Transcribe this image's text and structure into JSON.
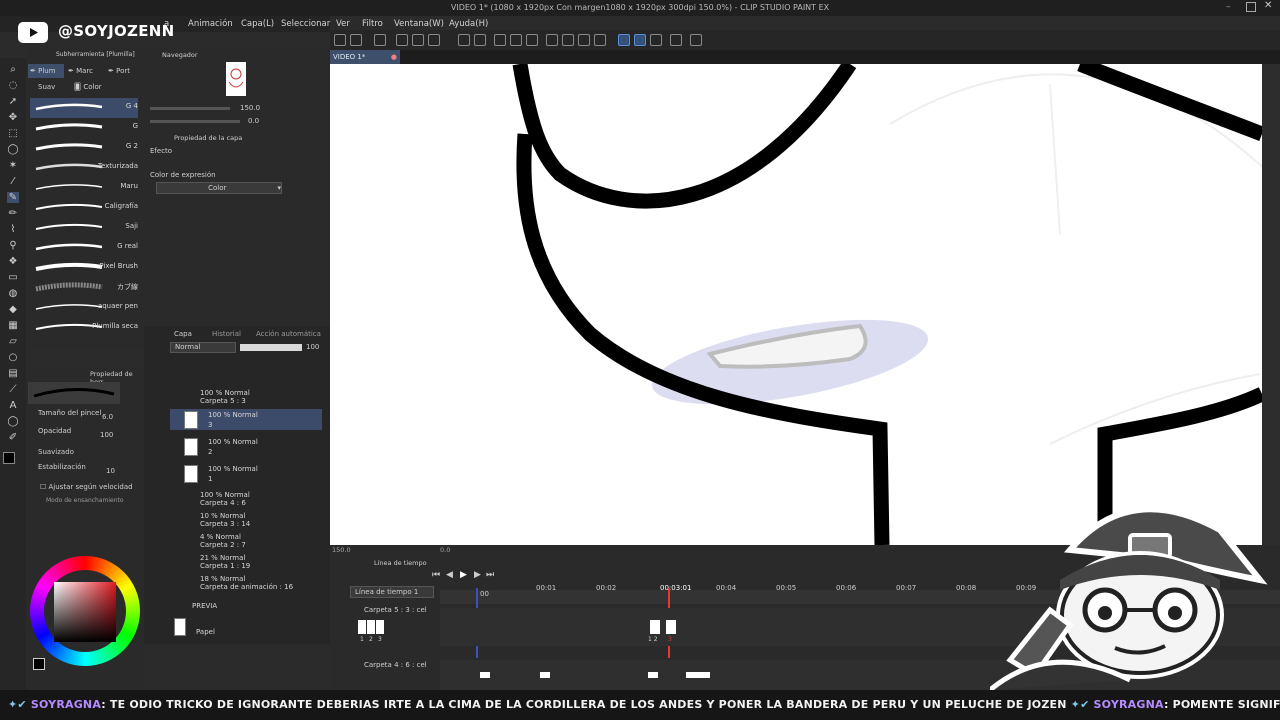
{
  "window": {
    "title": "VIDEO 1* (1080 x 1920px Con margen1080 x 1920px 300dpi 150.0%) - CLIP STUDIO PAINT EX"
  },
  "overlay": {
    "channel": "@SOYJOZENN",
    "logo_icon": "youtube-play-icon"
  },
  "menu": [
    "a",
    "Animación",
    "Capa(L)",
    "Seleccionar",
    "Ver",
    "Filtro",
    "Ventana(W)",
    "Ayuda(H)"
  ],
  "canvas": {
    "tab": "VIDEO 1*",
    "zoom": "150.0",
    "rotation": "0.0"
  },
  "navigator": {
    "title": "Navegador",
    "zoom": "150.0",
    "angle": "0.0"
  },
  "subtool": {
    "title": "Subherramienta [Plumilla]",
    "tabs": [
      "Plum",
      "Marc",
      "Port"
    ],
    "tabs2": [
      "Suav",
      "Color"
    ],
    "brushes": [
      "G 4",
      "G",
      "G 2",
      "Texturizada",
      "Maru",
      "Caligrafía",
      "Saji",
      "G real",
      "Pixel Brush",
      "カブ線",
      "aquaer pen",
      "Plumilla seca"
    ]
  },
  "layer_property": {
    "title": "Propiedad de la capa",
    "effect": "Efecto",
    "expression_color_label": "Color de expresión",
    "expression_color_value": "Color"
  },
  "tool_property": {
    "title": "Propiedad de herr",
    "brush_size_label": "Tamaño del pincel",
    "brush_size": "6.0",
    "opacity_label": "Opacidad",
    "opacity": "100",
    "smoothing_label": "Suavizado",
    "stabilization_label": "Estabilización",
    "stabilization": "10",
    "speed_label": "Ajustar según velocidad",
    "mode_label": "Modo de ensanchamiento"
  },
  "layers": {
    "tabs": [
      "Capa",
      "Historial",
      "Acción automática"
    ],
    "blend": "Normal",
    "opacity": "100",
    "rows": [
      {
        "line1": "100 % Normal",
        "line2": "Carpeta 5 : 3"
      },
      {
        "line1": "100 % Normal",
        "line2": "3"
      },
      {
        "line1": "100 % Normal",
        "line2": "2"
      },
      {
        "line1": "100 % Normal",
        "line2": "1"
      },
      {
        "line1": "100 % Normal",
        "line2": "Carpeta 4 : 6"
      },
      {
        "line1": "10 % Normal",
        "line2": "Carpeta 3 : 14"
      },
      {
        "line1": "4 % Normal",
        "line2": "Carpeta 2 : 7"
      },
      {
        "line1": "21 % Normal",
        "line2": "Carpeta 1 : 19"
      },
      {
        "line1": "18 % Normal",
        "line2": "Carpeta de animación : 16"
      },
      {
        "line1": "PREVIA",
        "line2": ""
      },
      {
        "line1": "Papel",
        "line2": ""
      }
    ]
  },
  "timeline": {
    "title": "Línea de tiempo",
    "name": "Línea de tiempo 1",
    "current_time": "00:03:01",
    "track1": "Carpeta 5 : 3 : cel",
    "track2": "Carpeta 4 : 6 : cel",
    "seconds": [
      "00",
      "00:01",
      "00:02",
      "00:03",
      "00:04",
      "00:05",
      "00:06",
      "00:07",
      "00:08",
      "00:09"
    ],
    "frame_labels": [
      "1",
      "2",
      "3"
    ],
    "cel_labels": [
      "1 2",
      "3"
    ]
  },
  "ticker": {
    "user": "SOYRAGNA",
    "message": "TE ODIO TRICKO DE IGNORANTE DEBERIAS IRTE A LA CIMA DE LA CORDILLERA DE LOS ANDES Y PONER LA BANDERA DE PERU Y UN PELUCHE DE JOZEN",
    "user2": "SOYRAGNA",
    "message2": "PO",
    "tail": "MENTE SIGNIFIC"
  },
  "colors": {
    "accent": "#5a8fd6",
    "selected_layer": "#3d4b6a",
    "playhead": "#e53935"
  }
}
